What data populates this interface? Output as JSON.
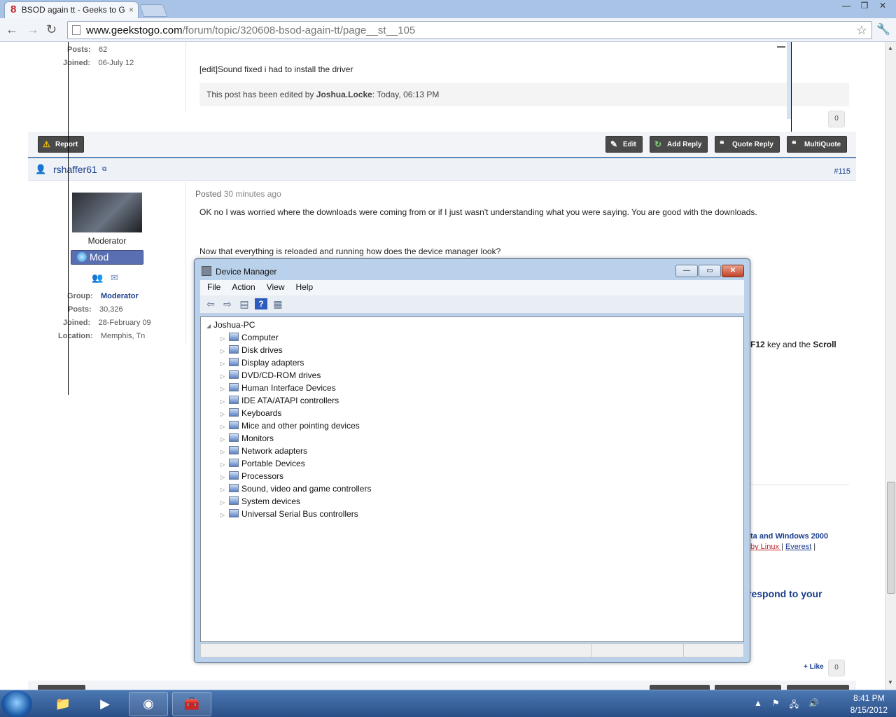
{
  "browser": {
    "tab_title": "BSOD again tt - Geeks to G",
    "tab_icon": "8",
    "tab_close": "×",
    "url_domain": "www.geekstogo.com",
    "url_path": "/forum/topic/320608-bsod-again-tt/page__st__105",
    "window_controls": [
      "—",
      "❐",
      "✕"
    ]
  },
  "post_top": {
    "posts_label": "Posts:",
    "posts_value": "62",
    "joined_label": "Joined:",
    "joined_value": "06-July 12",
    "body": "[edit]Sound fixed i had to install the driver",
    "edited_prefix": "This post has been edited by ",
    "edited_by": "Joshua.Locke",
    "edited_suffix": ": Today, 06:13 PM",
    "like_count": "0",
    "buttons": {
      "report": "Report",
      "edit": "Edit",
      "add_reply": "Add Reply",
      "quote_reply": "Quote Reply",
      "multiquote": "MultiQuote"
    }
  },
  "post_main": {
    "author": "rshaffer61",
    "post_number": "#115",
    "posted_prefix": "Posted ",
    "posted_time": "30 minutes ago",
    "role": "Moderator",
    "badge": "Mod",
    "group_label": "Group:",
    "group_value": "Moderator",
    "posts_label": "Posts:",
    "posts_value": "30,326",
    "joined_label": "Joined:",
    "joined_value": "28-February 09",
    "location_label": "Location:",
    "location_value": "Memphis, Tn",
    "body1": "OK no I was worried where the downloads were coming from or if I just wasn't understanding what you were saying. You are good with the downloads.",
    "body2": "Now that everything is reloaded and running how does the device manager look?",
    "partial_f12": "F12",
    "partial_key_and_the": " key and the ",
    "partial_scroll": "Scroll",
    "sig_line1": "ta and Windows 2000",
    "sig_link1": "by Linux ",
    "sig_sep1": "|",
    "sig_link2": "Everest",
    "sig_sep2": " |",
    "sig_line3": "respond to your",
    "like_label": "+ Like",
    "like_count": "0"
  },
  "device_manager": {
    "title": "Device Manager",
    "menu": [
      "File",
      "Action",
      "View",
      "Help"
    ],
    "root": "Joshua-PC",
    "items": [
      "Computer",
      "Disk drives",
      "Display adapters",
      "DVD/CD-ROM drives",
      "Human Interface Devices",
      "IDE ATA/ATAPI controllers",
      "Keyboards",
      "Mice and other pointing devices",
      "Monitors",
      "Network adapters",
      "Portable Devices",
      "Processors",
      "Sound, video and game controllers",
      "System devices",
      "Universal Serial Bus controllers"
    ]
  },
  "taskbar": {
    "time": "8:41 PM",
    "date": "8/15/2012"
  },
  "colors": {
    "link_blue": "#1a3e8c",
    "button_dark": "#4a4a4a",
    "mod_badge": "#5a6fb2"
  }
}
